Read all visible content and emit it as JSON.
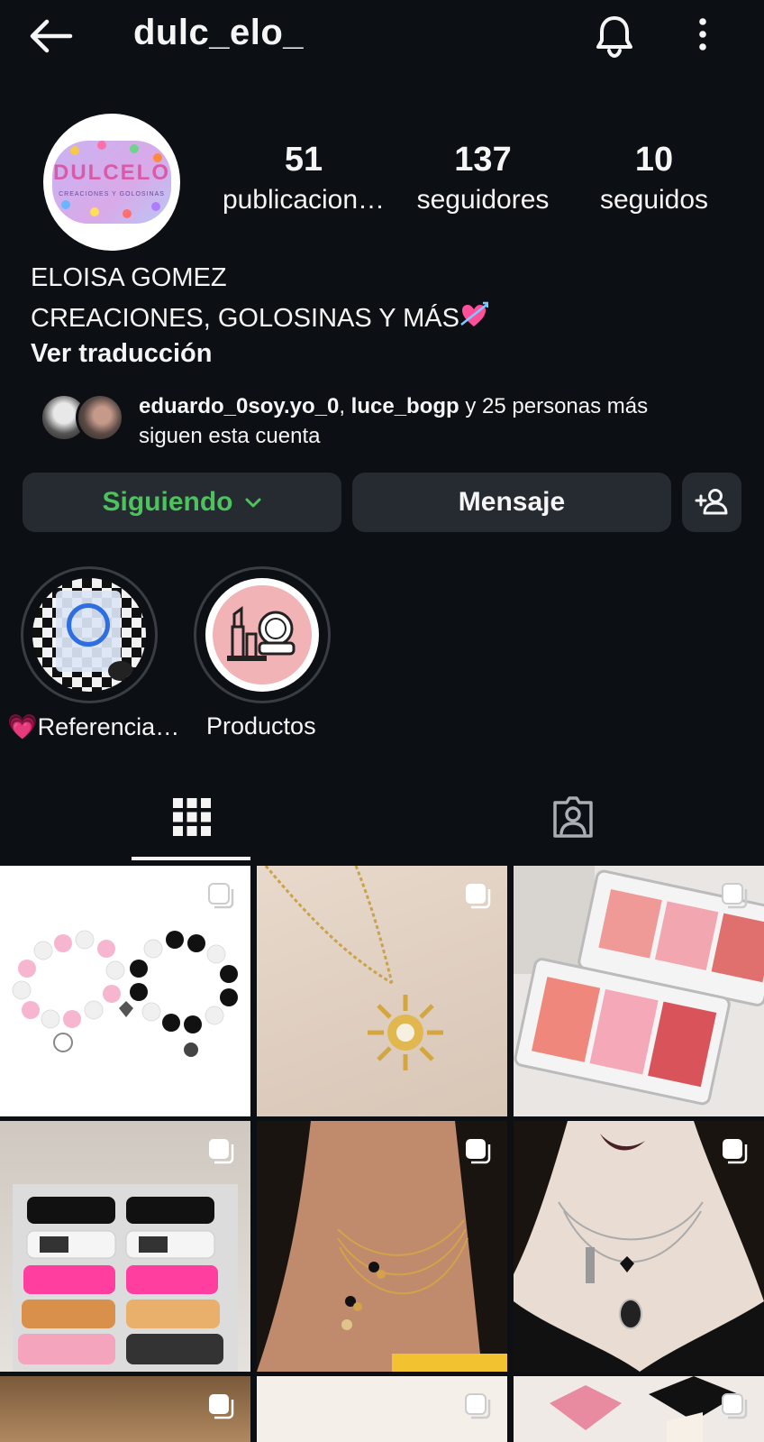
{
  "header": {
    "username": "dulc_elo_",
    "back_icon": "arrow-left-icon",
    "bell_icon": "bell-icon",
    "more_icon": "more-vertical-icon"
  },
  "profile": {
    "avatar_logo": "DULCELO",
    "avatar_logo_sub": "CREACIONES Y GOLOSINAS",
    "stats": [
      {
        "value": "51",
        "label": "publicacion…"
      },
      {
        "value": "137",
        "label": "seguidores"
      },
      {
        "value": "10",
        "label": "seguidos"
      }
    ],
    "name": "ELOISA GOMEZ",
    "bio": "CREACIONES, GOLOSINAS Y MÁS",
    "bio_emoji": "heart-with-arrow-emoji",
    "translate_label": "Ver traducción"
  },
  "followed_by": {
    "user1": "eduardo_0soy.yo_0",
    "separator": ", ",
    "user2": "luce_bogp",
    "rest_line1": " y 25 personas más",
    "line2": "siguen esta cuenta"
  },
  "actions": {
    "following_label": "Siguiendo",
    "message_label": "Mensaje",
    "add_icon": "add-person-icon"
  },
  "highlights": [
    {
      "label": "💗Referencia…"
    },
    {
      "label": "Productos"
    }
  ],
  "tabs": {
    "grid_icon": "grid-icon",
    "tagged_icon": "tagged-person-icon"
  },
  "colors": {
    "background": "#0c0f14",
    "button_bg": "#262a31",
    "following_green": "#4cc35c",
    "text": "#f5f5f5"
  }
}
